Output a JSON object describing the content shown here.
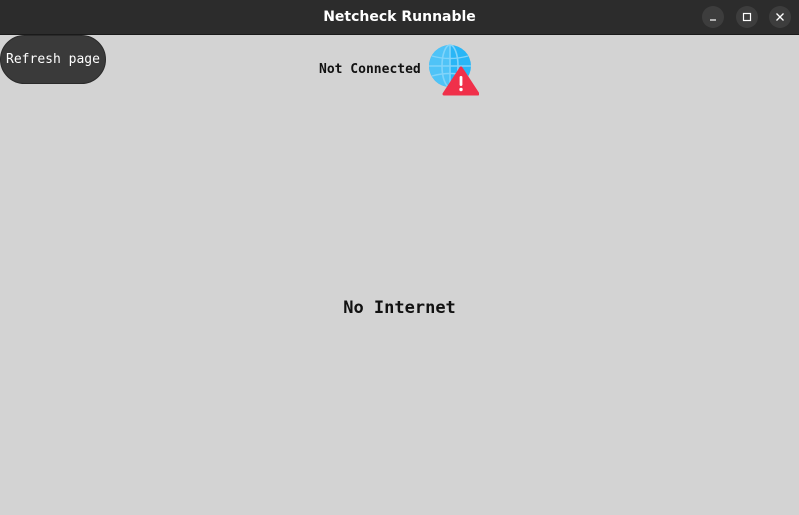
{
  "window": {
    "title": "Netcheck Runnable"
  },
  "toolbar": {
    "refresh_label": "Refresh page"
  },
  "status": {
    "label": "Not Connected",
    "icon": "globe-warning-icon"
  },
  "main": {
    "message": "No Internet"
  },
  "colors": {
    "background": "#d3d3d3",
    "titlebar": "#2c2c2c",
    "button": "#3a3a3a",
    "globe": "#29b6f6",
    "warning": "#f0304a"
  }
}
